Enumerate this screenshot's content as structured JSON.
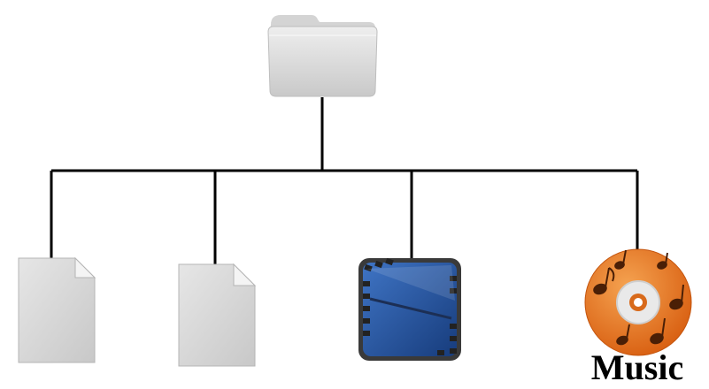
{
  "diagram": {
    "root": {
      "icon": "folder-icon"
    },
    "children": [
      {
        "icon": "document-icon",
        "label": ""
      },
      {
        "icon": "document-icon",
        "label": ""
      },
      {
        "icon": "video-film-icon",
        "label": ""
      },
      {
        "icon": "music-disc-icon",
        "label": "Music"
      }
    ],
    "colors": {
      "connector": "#000000",
      "folder": "#d8d8d8",
      "document": "#dcdcdc",
      "video": "#2f5ea8",
      "music": "#e8741e"
    }
  }
}
